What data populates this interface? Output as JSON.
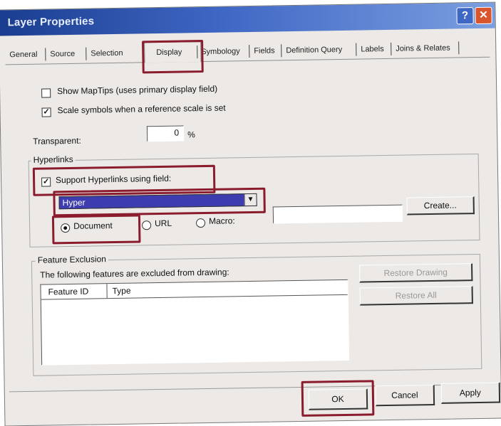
{
  "window": {
    "title": "Layer Properties",
    "help_glyph": "?",
    "close_glyph": "✕"
  },
  "tabs": [
    {
      "label": "General"
    },
    {
      "label": "Source"
    },
    {
      "label": "Selection"
    },
    {
      "label": "Display"
    },
    {
      "label": "Symbology"
    },
    {
      "label": "Fields"
    },
    {
      "label": "Definition Query"
    },
    {
      "label": "Labels"
    },
    {
      "label": "Joins & Relates"
    }
  ],
  "display": {
    "show_maptips": {
      "label": "Show MapTips (uses primary display field)",
      "checked": false
    },
    "scale_symbols": {
      "label": "Scale symbols when a reference scale is set",
      "checked": true,
      "mark": "✓"
    },
    "transparent": {
      "label": "Transparent:",
      "value": "0",
      "unit": "%"
    }
  },
  "hyperlinks": {
    "group_title": "Hyperlinks",
    "support": {
      "label": "Support Hyperlinks using field:",
      "checked": true,
      "mark": "✓"
    },
    "field_value": "Hyper",
    "dropdown_glyph": "▼",
    "radio_document": "Document",
    "radio_url": "URL",
    "radio_macro": "Macro:",
    "macro_value": "",
    "create_button": "Create..."
  },
  "feature_exclusion": {
    "group_title": "Feature Exclusion",
    "description": "The following features are excluded from drawing:",
    "columns": [
      "Feature ID",
      "Type"
    ],
    "restore_drawing_button": "Restore Drawing",
    "restore_all_button": "Restore All"
  },
  "footer": {
    "ok": "OK",
    "cancel": "Cancel",
    "apply": "Apply"
  },
  "colors": {
    "highlight": "#8b1c2e",
    "title_bar": "#1a3d8f",
    "combo_selected": "#3d3db0"
  }
}
